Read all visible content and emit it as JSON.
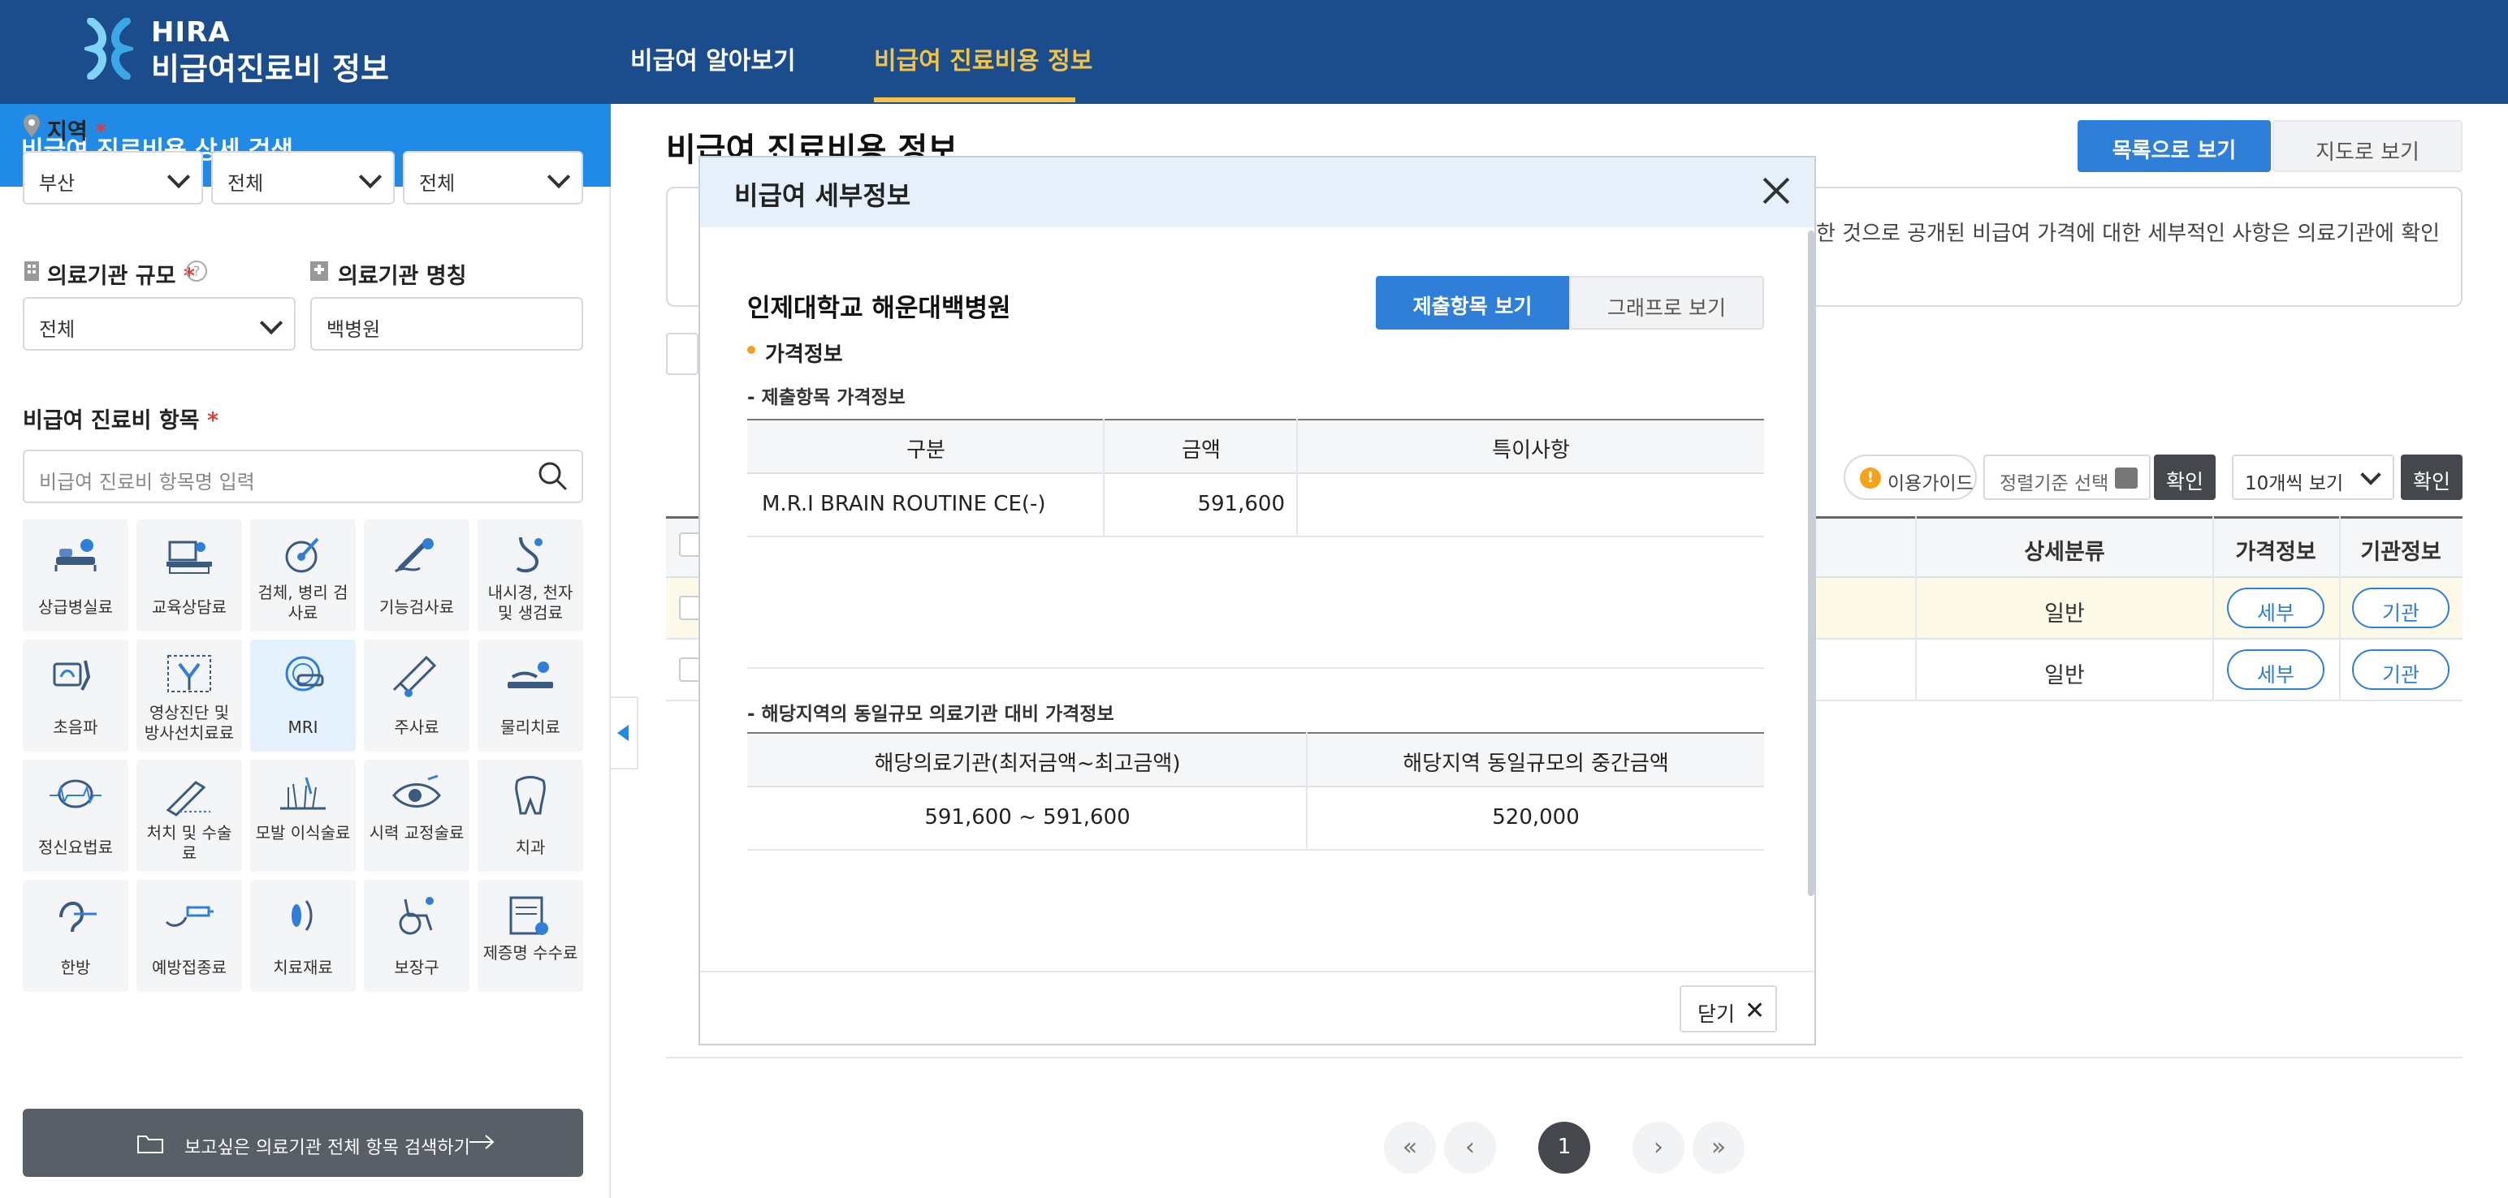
{
  "header": {
    "logo_line1": "HIRA",
    "logo_line2": "비급여진료비 정보",
    "nav": [
      "비급여 알아보기",
      "비급여 진료비용 정보"
    ]
  },
  "sidebar": {
    "title": "비급여 진료비용 상세 검색",
    "region_label": "지역",
    "region_selects": [
      "부산",
      "전체",
      "전체"
    ],
    "scale_label": "의료기관 규모",
    "scale_value": "전체",
    "name_label": "의료기관 명칭",
    "name_value": "백병원",
    "items_label": "비급여 진료비 항목",
    "items_placeholder": "비급여 진료비 항목명 입력",
    "categories": [
      {
        "label": "상급병실료",
        "icon": "bed-icon"
      },
      {
        "label": "교육상담료",
        "icon": "counseling-icon"
      },
      {
        "label": "검체, 병리 검사료",
        "icon": "specimen-icon"
      },
      {
        "label": "기능검사료",
        "icon": "function-test-icon"
      },
      {
        "label": "내시경, 천자 및 생검료",
        "icon": "endoscope-icon"
      },
      {
        "label": "초음파",
        "icon": "ultrasound-icon"
      },
      {
        "label": "영상진단 및 방사선치료료",
        "icon": "radiology-icon"
      },
      {
        "label": "MRI",
        "icon": "mri-icon"
      },
      {
        "label": "주사료",
        "icon": "syringe-icon"
      },
      {
        "label": "물리치료",
        "icon": "physical-therapy-icon"
      },
      {
        "label": "정신요법료",
        "icon": "brain-icon"
      },
      {
        "label": "처치 및 수술료",
        "icon": "scalpel-icon"
      },
      {
        "label": "모발 이식술료",
        "icon": "hair-icon"
      },
      {
        "label": "시력 교정술료",
        "icon": "eye-icon"
      },
      {
        "label": "치과",
        "icon": "tooth-icon"
      },
      {
        "label": "한방",
        "icon": "acupuncture-icon"
      },
      {
        "label": "예방접종료",
        "icon": "vaccine-icon"
      },
      {
        "label": "치료재료",
        "icon": "material-icon"
      },
      {
        "label": "보장구",
        "icon": "wheelchair-icon"
      },
      {
        "label": "제증명 수수료",
        "icon": "certificate-icon"
      }
    ],
    "search_all_button": "보고싶은 의료기관 전체 항목 검색하기"
  },
  "main": {
    "title": "비급여 진료비용 정보",
    "view_list": "목록으로 보기",
    "view_map": "지도로 보기",
    "notice_text": "한 것으로 공개된 비급여 가격에 대한 세부적인 사항은 의료기관에 확인",
    "guide_button": "이용가이드",
    "sort_placeholder": "정렬기준 선택",
    "confirm": "확인",
    "per_page": "10개씩 보기",
    "columns": [
      "상세분류",
      "가격정보",
      "기관정보"
    ],
    "rows": [
      {
        "category": "일반",
        "price_btn": "세부",
        "org_btn": "기관"
      },
      {
        "category": "일반",
        "price_btn": "세부",
        "org_btn": "기관"
      }
    ],
    "pagination": {
      "current": "1"
    }
  },
  "modal": {
    "title": "비급여 세부정보",
    "hospital": "인제대학교 해운대백병원",
    "tab_items": "제출항목 보기",
    "tab_graph": "그래프로 보기",
    "section": "가격정보",
    "sub1": "- 제출항목 가격정보",
    "t1_headers": [
      "구분",
      "금액",
      "특이사항"
    ],
    "t1_rows": [
      {
        "name": "M.R.I BRAIN ROUTINE CE(-)",
        "amount": "591,600",
        "note": ""
      }
    ],
    "sub2": "- 해당지역의 동일규모 의료기관 대비 가격정보",
    "t2_headers": [
      "해당의료기관(최저금액~최고금액)",
      "해당지역 동일규모의 중간금액"
    ],
    "t2_rows": [
      {
        "range": "591,600 ~ 591,600",
        "median": "520,000"
      }
    ],
    "close_label": "닫기"
  },
  "colors": {
    "header": "#1b4d8c",
    "accent": "#1f8be6",
    "nav_active": "#f5c242"
  }
}
